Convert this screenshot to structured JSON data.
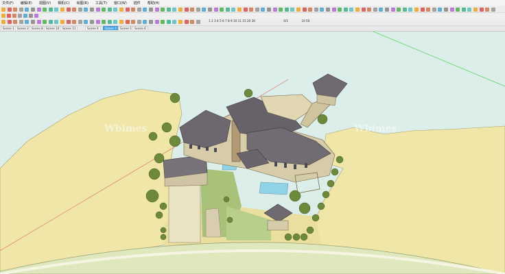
{
  "menu": {
    "items": [
      "文件(F)",
      "编辑(E)",
      "视图(V)",
      "相机(C)",
      "绘图(R)",
      "工具(T)",
      "窗口(W)",
      "插件",
      "帮助(H)"
    ]
  },
  "toolbar": {
    "scale_label": "1 2 3 4 5 6 7 8 9 10 11 15 20 30",
    "scale_value": "0/1",
    "scale_extra": "10 50"
  },
  "scenes": {
    "tabs": [
      "Scene 1",
      "Scene 2",
      "Scene 8",
      "Scene 10",
      "Scene 11",
      "Scene 4",
      "Scene 7",
      "Scene 5",
      "Scene 6"
    ],
    "active": 6
  },
  "watermarks": [
    "Wbimes",
    "Wbimes"
  ],
  "colors": {
    "sky": "#dceee9",
    "grass": "#efe6a8",
    "road": "#dfe7bc",
    "roof": "#6d6870",
    "stone": "#b4a987",
    "accent_active_tab": "#4aa3e6"
  }
}
